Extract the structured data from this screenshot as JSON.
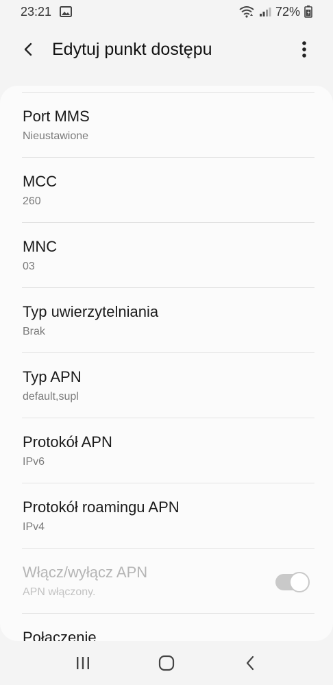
{
  "status_bar": {
    "time": "23:21",
    "battery": "72%",
    "icons": [
      "image-icon",
      "wifi-icon",
      "signal-icon",
      "battery-icon"
    ]
  },
  "app_bar": {
    "title": "Edytuj punkt dostępu",
    "back_icon": "back-arrow-icon",
    "menu_icon": "more-vert-icon"
  },
  "items": [
    {
      "title": "Port MMS",
      "value": "Nieustawione"
    },
    {
      "title": "MCC",
      "value": "260"
    },
    {
      "title": "MNC",
      "value": "03"
    },
    {
      "title": "Typ uwierzytelniania",
      "value": "Brak"
    },
    {
      "title": "Typ APN",
      "value": "default,supl"
    },
    {
      "title": "Protokół APN",
      "value": "IPv6"
    },
    {
      "title": "Protokół roamingu APN",
      "value": "IPv4"
    },
    {
      "title": "Włącz/wyłącz APN",
      "value": "APN włączony.",
      "toggle_on": true,
      "disabled": true
    },
    {
      "title": "Połączenie",
      "value": ""
    }
  ],
  "nav_bar": {
    "icons": [
      "recents-icon",
      "home-icon",
      "back-icon"
    ]
  },
  "colors": {
    "background": "#f4f4f4",
    "card": "#fbfbfb",
    "divider": "#e2e2e2",
    "secondary_text": "#7a7a7a",
    "disabled_text": "#b5b5b5"
  }
}
